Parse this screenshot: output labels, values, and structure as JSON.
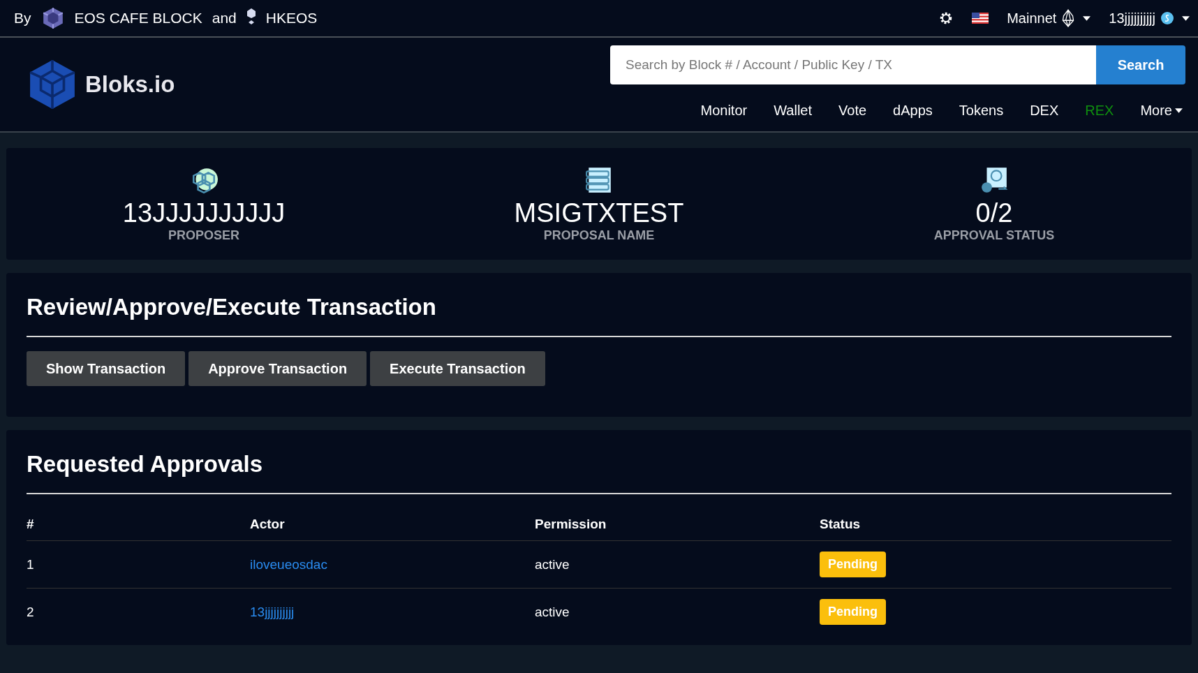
{
  "top_bar": {
    "by": "By",
    "sponsor_1": "EOS CAFE BLOCK",
    "and": "and",
    "sponsor_2": "HKEOS",
    "network": "Mainnet",
    "account": "13jjjjjjjjjj"
  },
  "header": {
    "logo": "Bloks.io",
    "search": {
      "placeholder": "Search by Block # / Account / Public Key / TX",
      "button": "Search"
    },
    "nav": [
      {
        "label": "Monitor",
        "color": "#ffffff",
        "dropdown": false
      },
      {
        "label": "Wallet",
        "color": "#ffffff",
        "dropdown": false
      },
      {
        "label": "Vote",
        "color": "#ffffff",
        "dropdown": false
      },
      {
        "label": "dApps",
        "color": "#ffffff",
        "dropdown": false
      },
      {
        "label": "Tokens",
        "color": "#ffffff",
        "dropdown": false
      },
      {
        "label": "DEX",
        "color": "#ffffff",
        "dropdown": false
      },
      {
        "label": "REX",
        "color": "#0f8f0f",
        "dropdown": false
      },
      {
        "label": "More",
        "color": "#ffffff",
        "dropdown": true
      }
    ]
  },
  "stats": [
    {
      "kind": "proposer",
      "value": "13JJJJJJJJJJ",
      "label": "PROPOSER"
    },
    {
      "kind": "name",
      "value": "MSIGTXTEST",
      "label": "PROPOSAL NAME"
    },
    {
      "kind": "approval",
      "value": "0/2",
      "label": "APPROVAL STATUS"
    }
  ],
  "review": {
    "title": "Review/Approve/Execute Transaction",
    "buttons": [
      "Show Transaction",
      "Approve Transaction",
      "Execute Transaction"
    ]
  },
  "approvals": {
    "title": "Requested Approvals",
    "columns": [
      "#",
      "Actor",
      "Permission",
      "Status"
    ],
    "rows": [
      {
        "index": "1",
        "actor": "iloveueosdac",
        "permission": "active",
        "status": "Pending"
      },
      {
        "index": "2",
        "actor": "13jjjjjjjjjj",
        "permission": "active",
        "status": "Pending"
      }
    ]
  }
}
